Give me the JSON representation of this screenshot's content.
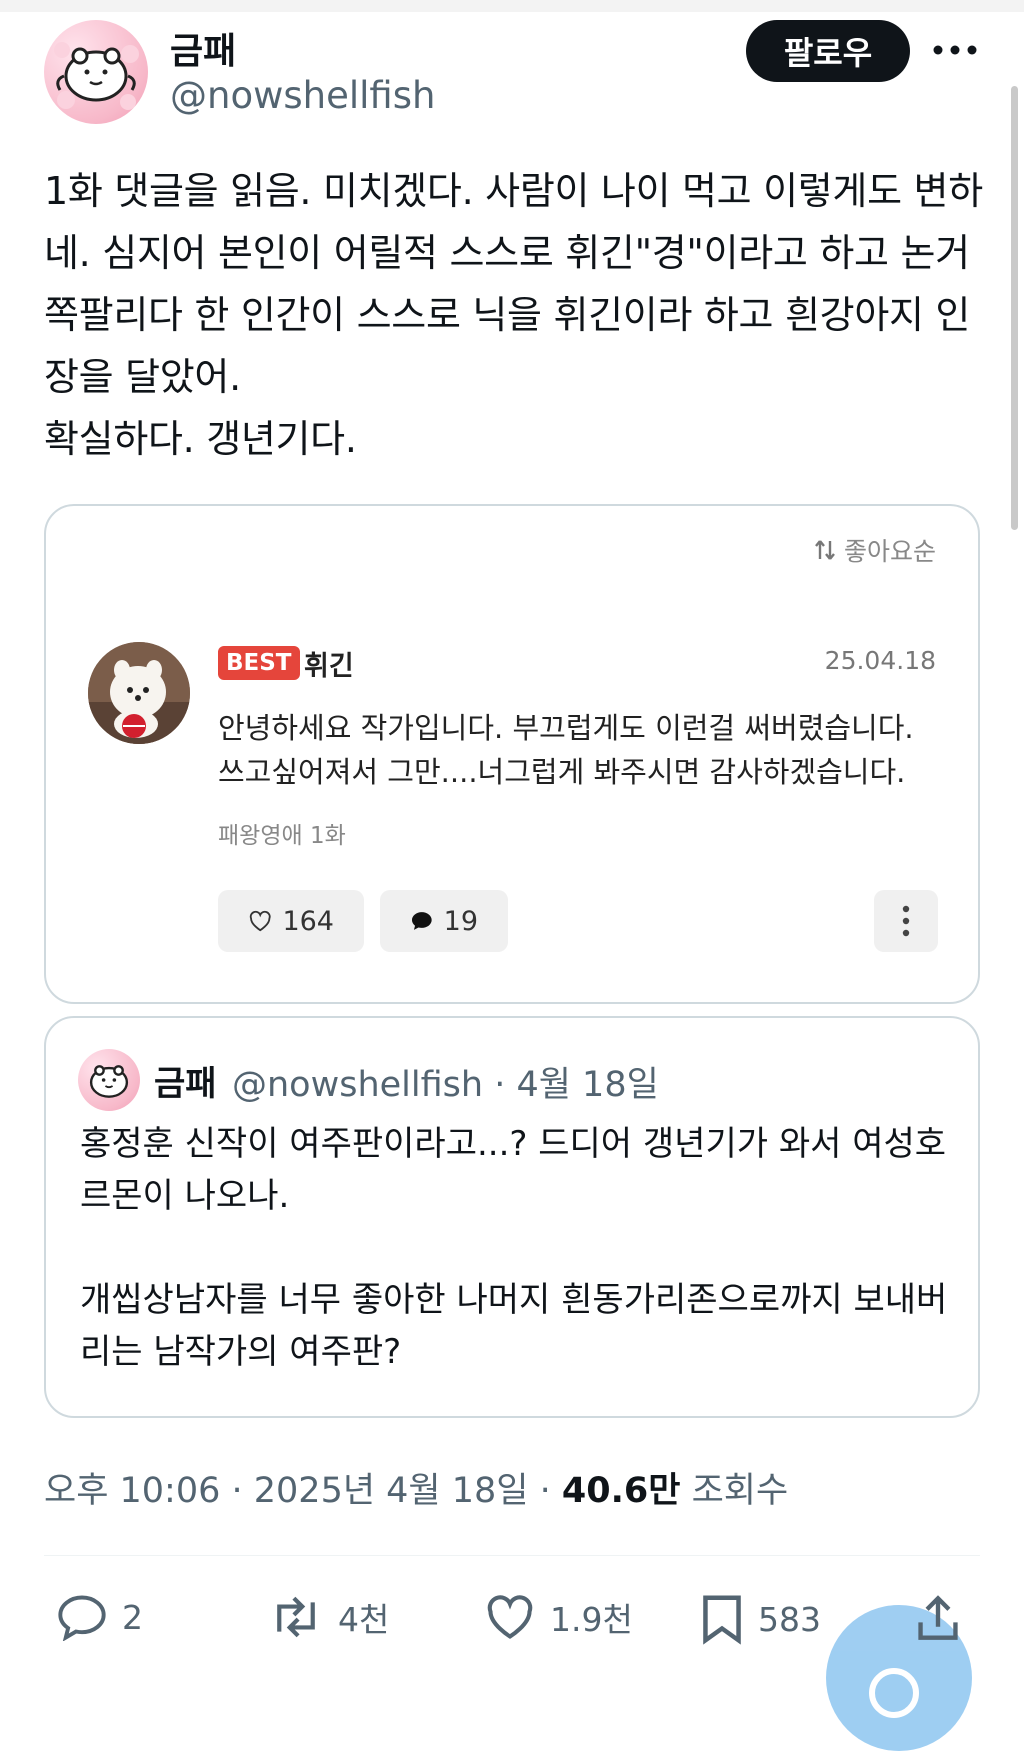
{
  "header": {
    "display_name": "금패",
    "handle": "@nowshellfish",
    "follow_label": "팔로우",
    "more_icon": "more-horizontal-icon"
  },
  "tweet": {
    "text": "1화 댓글을 읽음. 미치겠다. 사람이 나이 먹고 이렇게도 변하네. 심지어 본인이 어릴적 스스로 휘긴\"경\"이라고 하고 논거 쪽팔리다 한 인간이 스스로 닉을 휘긴이라 하고 흰강아지 인장을 달았어.\n확실하다. 갱년기다."
  },
  "image_card": {
    "sort_label": "좋아요순",
    "badge": "BEST",
    "author": "휘긴",
    "date": "25.04.18",
    "text": "안녕하세요 작가입니다. 부끄럽게도 이런걸 써버렸습니다.\n쓰고싶어져서 그만....너그럽게 봐주시면 감사하겠습니다.",
    "episode": "패왕영애 1화",
    "likes": "164",
    "replies": "19"
  },
  "quote": {
    "name": "금패",
    "meta": "@nowshellfish · 4월 18일",
    "text": "홍정훈 신작이 여주판이라고...? 드디어 갱년기가 와서 여성호르몬이 나오나.\n\n개씹상남자를 너무 좋아한 나머지 흰동가리존으로까지 보내버리는 남작가의 여주판?"
  },
  "meta": {
    "time_date": "오후 10:06 · 2025년 4월 18일 · ",
    "views_count": "40.6만",
    "views_label": "조회수"
  },
  "actions": {
    "reply_count": "2",
    "retweet_count": "4천",
    "like_count": "1.9천",
    "bookmark_count": "583"
  },
  "colors": {
    "text": "#0f1419",
    "secondary": "#536471",
    "best_badge": "#e5453b",
    "border": "#cfd9de",
    "fab": "#8ec6f0"
  }
}
